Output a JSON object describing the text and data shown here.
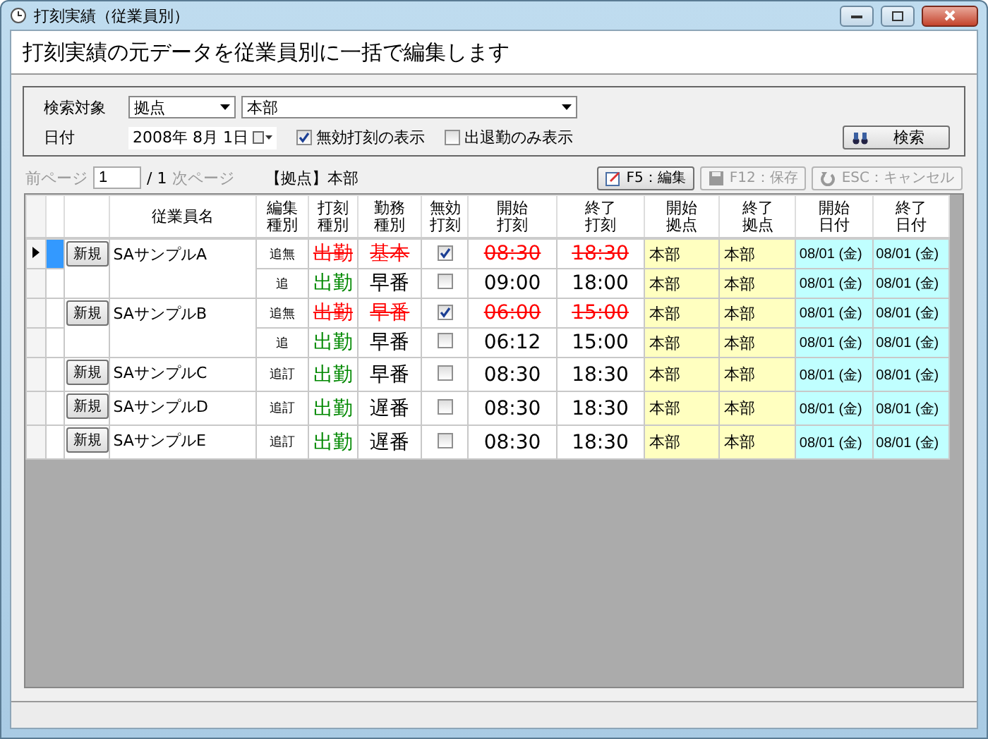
{
  "window": {
    "title": "打刻実績（従業員別）"
  },
  "heading": "打刻実績の元データを従業員別に一括で編集します",
  "search": {
    "target_label": "検索対象",
    "target_type": "拠点",
    "target_value": "本部",
    "date_label": "日付",
    "date_value": "2008年  8月  1日",
    "options": [
      {
        "label": "無効打刻の表示",
        "checked": true
      },
      {
        "label": "出退勤のみ表示",
        "checked": false
      }
    ],
    "button": "検索"
  },
  "pager": {
    "prev": "前ページ",
    "page": "1",
    "total": "/ 1",
    "next": "次ページ",
    "filter": "【拠点】本部"
  },
  "actions": [
    {
      "label": "F5：編集",
      "disabled": false,
      "kind": "edit"
    },
    {
      "label": "F12：保存",
      "disabled": true,
      "kind": "save"
    },
    {
      "label": "ESC：キャンセル",
      "disabled": true,
      "kind": "cancel"
    }
  ],
  "table": {
    "columns": [
      "従業員名",
      "編集種別",
      "打刻種別",
      "勤務種別",
      "無効打刻",
      "開始打刻",
      "終了打刻",
      "開始拠点",
      "終了拠点",
      "開始日付",
      "終了日付"
    ],
    "employees": [
      {
        "name": "SAサンプルA",
        "new_label": "新規",
        "current": true,
        "records": [
          {
            "edit": "追無",
            "punch": "出勤",
            "shift": "基本",
            "invalid": true,
            "start": "08:30",
            "end": "18:30",
            "start_site": "本部",
            "end_site": "本部",
            "start_date": "08/01 (金)",
            "end_date": "08/01 (金)"
          },
          {
            "edit": "追",
            "punch": "出勤",
            "shift": "早番",
            "invalid": false,
            "start": "09:00",
            "end": "18:00",
            "start_site": "本部",
            "end_site": "本部",
            "start_date": "08/01 (金)",
            "end_date": "08/01 (金)"
          }
        ]
      },
      {
        "name": "SAサンプルB",
        "new_label": "新規",
        "current": false,
        "records": [
          {
            "edit": "追無",
            "punch": "出勤",
            "shift": "早番",
            "invalid": true,
            "start": "06:00",
            "end": "15:00",
            "start_site": "本部",
            "end_site": "本部",
            "start_date": "08/01 (金)",
            "end_date": "08/01 (金)"
          },
          {
            "edit": "追",
            "punch": "出勤",
            "shift": "早番",
            "invalid": false,
            "start": "06:12",
            "end": "15:00",
            "start_site": "本部",
            "end_site": "本部",
            "start_date": "08/01 (金)",
            "end_date": "08/01 (金)"
          }
        ]
      },
      {
        "name": "SAサンプルC",
        "new_label": "新規",
        "current": false,
        "records": [
          {
            "edit": "追訂",
            "punch": "出勤",
            "shift": "早番",
            "invalid": false,
            "start": "08:30",
            "end": "18:30",
            "start_site": "本部",
            "end_site": "本部",
            "start_date": "08/01 (金)",
            "end_date": "08/01 (金)"
          }
        ]
      },
      {
        "name": "SAサンプルD",
        "new_label": "新規",
        "current": false,
        "records": [
          {
            "edit": "追訂",
            "punch": "出勤",
            "shift": "遅番",
            "invalid": false,
            "start": "08:30",
            "end": "18:30",
            "start_site": "本部",
            "end_site": "本部",
            "start_date": "08/01 (金)",
            "end_date": "08/01 (金)"
          }
        ]
      },
      {
        "name": "SAサンプルE",
        "new_label": "新規",
        "current": false,
        "records": [
          {
            "edit": "追訂",
            "punch": "出勤",
            "shift": "遅番",
            "invalid": false,
            "start": "08:30",
            "end": "18:30",
            "start_site": "本部",
            "end_site": "本部",
            "start_date": "08/01 (金)",
            "end_date": "08/01 (金)"
          }
        ]
      }
    ]
  }
}
